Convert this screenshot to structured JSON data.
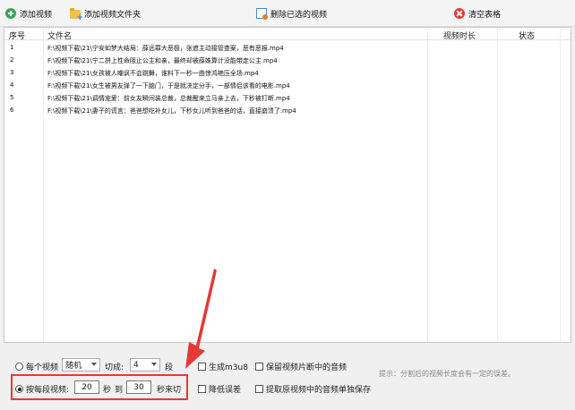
{
  "toolbar": {
    "add_video": "添加视频",
    "add_folder": "添加视频文件夹",
    "delete_selected": "删除已选的视频",
    "clear_table": "清空表格"
  },
  "table": {
    "headers": {
      "index": "序号",
      "filename": "文件名",
      "duration": "视频时长",
      "status": "状态"
    },
    "rows": [
      {
        "index": "1",
        "filename": "F:\\视频下载\\21\\宁安如梦大结局：薛远罪大恶极，张遮主动接管查案，恶有恶报.mp4"
      },
      {
        "index": "2",
        "filename": "F:\\视频下载\\21\\宁二拼上性命阻止公主和亲，最终却被薛姝算计没能带走公主.mp4"
      },
      {
        "index": "3",
        "filename": "F:\\视频下载\\21\\女孩被人嘲讽不会跳舞，谁料下一秒一曲惊鸿艳压全场.mp4"
      },
      {
        "index": "4",
        "filename": "F:\\视频下载\\21\\女生被男友弹了一下脑门，于是就决定分手，一部情侣该看的电影.mp4"
      },
      {
        "index": "5",
        "filename": "F:\\视频下载\\21\\调情宠爱：前女友瞬间装总裁，总裁醒来立马亲上去，下秒被打断.mp4"
      },
      {
        "index": "6",
        "filename": "F:\\视频下载\\21\\妻子的谎言：爸爸想吃补女儿，下秒女儿听到爸爸的话，直接崩溃了.mp4"
      }
    ]
  },
  "options": {
    "per_video_label": "每个视频",
    "mode_select": "随机",
    "cut_into_label": "切成:",
    "segment_count": "4",
    "segment_unit": "段",
    "per_segment_label": "按每段视频:",
    "from_value": "20",
    "sec_label": "秒",
    "to_label": "到",
    "to_value": "30",
    "sec_end_label": "秒来切",
    "gen_m3u8": "生成m3u8",
    "reduce_error": "降低误差",
    "keep_audio": "保留视频片断中的音频",
    "extract_audio": "提取原视频中的音频单独保存",
    "hint": "提示：分割后的视频长度会有一定的误差。"
  }
}
